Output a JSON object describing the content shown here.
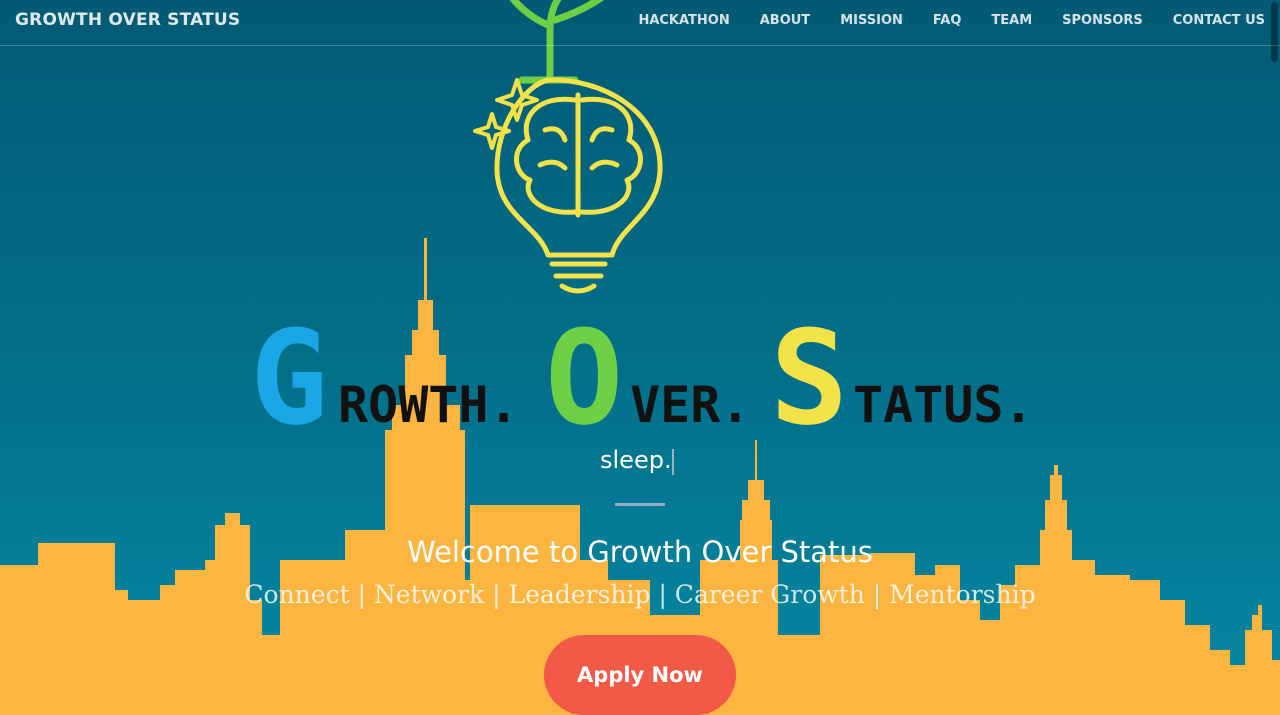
{
  "nav": {
    "brand": "GROWTH OVER STATUS",
    "links": [
      "HACKATHON",
      "ABOUT",
      "MISSION",
      "FAQ",
      "TEAM",
      "SPONSORS",
      "CONTACT US"
    ]
  },
  "hero": {
    "letters": [
      {
        "initial": "G",
        "rest": "ROWTH.",
        "color": "#1aa7e6"
      },
      {
        "initial": "O",
        "rest": "VER.",
        "color": "#6ccf45"
      },
      {
        "initial": "S",
        "rest": "TATUS.",
        "color": "#f4e24a"
      }
    ],
    "typed_text": "sleep.",
    "welcome": "Welcome to Growth Over Status",
    "tagline": "Connect | Network | Leadership | Career Growth | Mentorship",
    "cta_label": "Apply Now"
  },
  "colors": {
    "skyline": "#fbb540",
    "bulb": "#f4e24a",
    "sprout": "#6ccf45",
    "cta": "#f05a46"
  },
  "icons": [
    "lightbulb-brain-icon",
    "sprout-icon",
    "sparkle-icon",
    "city-skyline"
  ]
}
